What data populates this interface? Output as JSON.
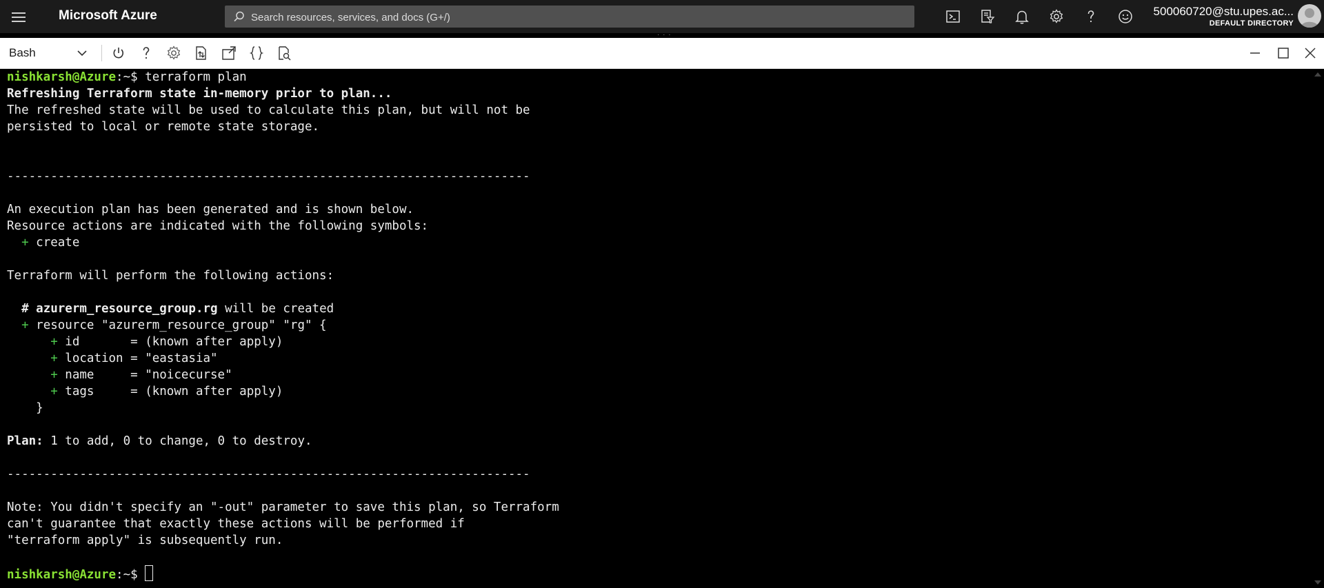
{
  "header": {
    "brand": "Microsoft Azure",
    "search_placeholder": "Search resources, services, and docs (G+/)",
    "icons": [
      "cloud-shell-icon",
      "directory-filter-icon",
      "bell-icon",
      "gear-icon",
      "help-icon",
      "feedback-smiley-icon"
    ],
    "account_email": "500060720@stu.upes.ac...",
    "account_directory": "DEFAULT DIRECTORY"
  },
  "toolbar": {
    "shell": "Bash",
    "buttons": [
      "power-icon",
      "help-icon",
      "settings-icon",
      "upload-download-icon",
      "open-new-session-icon",
      "editor-braces-icon",
      "web-preview-icon"
    ],
    "window_controls": [
      "minimize-icon",
      "maximize-icon",
      "close-icon"
    ]
  },
  "terminal": {
    "prompt_user": "nishkarsh@Azure",
    "prompt_path": ":~$ ",
    "command": "terraform plan",
    "refreshing": "Refreshing Terraform state in-memory prior to plan...",
    "refresh_note_1": "The refreshed state will be used to calculate this plan, but will not be",
    "refresh_note_2": "persisted to local or remote state storage.",
    "separator": "------------------------------------------------------------------------",
    "exec_1": "An execution plan has been generated and is shown below.",
    "exec_2": "Resource actions are indicated with the following symbols:",
    "plus": "+",
    "create": " create",
    "perform": "Terraform will perform the following actions:",
    "hash": "# ",
    "resource_addr": "azurerm_resource_group.rg",
    "will_create": " will be created",
    "resource_line": " resource \"azurerm_resource_group\" \"rg\" {",
    "attrs": [
      " id       = (known after apply)",
      " location = \"eastasia\"",
      " name     = \"noicecurse\"",
      " tags     = (known after apply)"
    ],
    "close_brace": "}",
    "plan_label": "Plan:",
    "plan_summary": " 1 to add, 0 to change, 0 to destroy.",
    "note_1": "Note: You didn't specify an \"-out\" parameter to save this plan, so Terraform",
    "note_2": "can't guarantee that exactly these actions will be performed if",
    "note_3": "\"terraform apply\" is subsequently run."
  }
}
